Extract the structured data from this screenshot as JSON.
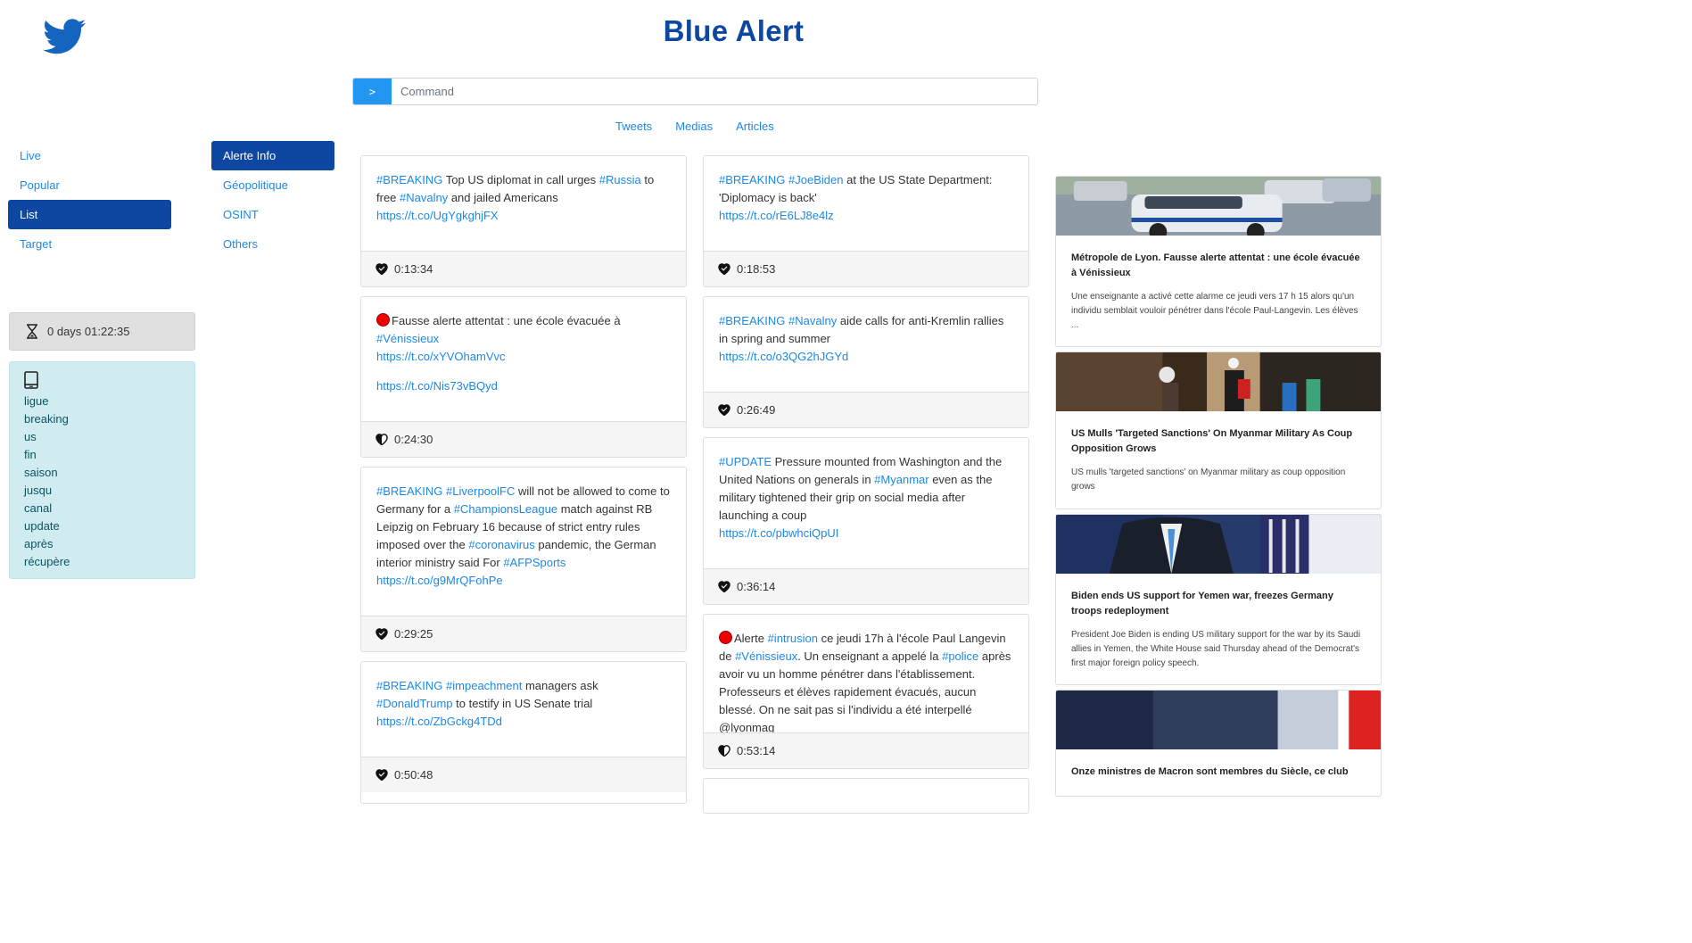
{
  "header": {
    "title": "Blue Alert",
    "logo_icon": "twitter-bird-icon",
    "brand_color": "#0d47a1",
    "accent_color": "#1e88e5"
  },
  "command": {
    "button_label": ">",
    "placeholder": "Command"
  },
  "tabs": [
    "Tweets",
    "Medias",
    "Articles"
  ],
  "nav": {
    "items": [
      "Live",
      "Popular",
      "List",
      "Target"
    ],
    "active": "List"
  },
  "subnav": {
    "items": [
      "Alerte Info",
      "Géopolitique",
      "OSINT",
      "Others"
    ],
    "active": "Alerte Info"
  },
  "timer": {
    "icon": "hourglass-icon",
    "text": "0 days 01:22:35"
  },
  "keywords": {
    "icon": "tablet-icon",
    "items": [
      "ligue",
      "breaking",
      "us",
      "fin",
      "saison",
      "jusqu",
      "canal",
      "update",
      "après",
      "récupère"
    ]
  },
  "tweets": {
    "t1": {
      "parts": [
        "#BREAKING",
        " Top US diplomat in call urges ",
        "#Russia",
        " to free ",
        "#Navalny",
        " and jailed Americans"
      ],
      "link": "https://t.co/UgYgkghjFX",
      "time": "0:13:34",
      "heart": "heart-full-icon"
    },
    "t2": {
      "parts": [
        "#BREAKING",
        " ",
        "#JoeBiden",
        " at the US State Department: 'Diplomacy is back'"
      ],
      "link": "https://t.co/rE6LJ8e4lz",
      "time": "0:18:53",
      "heart": "heart-full-icon"
    },
    "t3": {
      "parts": [
        "Fausse alerte attentat : une école évacuée à ",
        "#Vénissieux"
      ],
      "link": "https://t.co/xYVOhamVvc",
      "link2": "https://t.co/Nis73vBQyd",
      "time": "0:24:30",
      "heart": "heart-half-icon"
    },
    "t4": {
      "parts": [
        "#BREAKING",
        " ",
        "#Navalny",
        " aide calls for anti-Kremlin rallies in spring and summer"
      ],
      "link": "https://t.co/o3QG2hJGYd",
      "time": "0:26:49",
      "heart": "heart-full-icon"
    },
    "t5": {
      "parts": [
        "#BREAKING",
        " ",
        "#LiverpoolFC",
        " will not be allowed to come to Germany for a ",
        "#ChampionsLeague",
        " match against RB Leipzig on February 16 because of strict entry rules imposed over the ",
        "#coronavirus",
        " pandemic, the German interior ministry said For ",
        "#AFPSports"
      ],
      "link": "https://t.co/g9MrQFohPe",
      "time": "0:29:25",
      "heart": "heart-full-icon"
    },
    "t6": {
      "parts": [
        "#UPDATE",
        " Pressure mounted from Washington and the United Nations on generals in ",
        "#Myanmar",
        " even as the military tightened their grip on social media after launching a coup"
      ],
      "link": "https://t.co/pbwhciQpUI",
      "time": "0:36:14",
      "heart": "heart-full-icon"
    },
    "t7": {
      "parts": [
        "#BREAKING",
        " ",
        "#impeachment",
        " managers ask ",
        "#DonaldTrump",
        " to testify in US Senate trial"
      ],
      "link": "https://t.co/ZbGckg4TDd",
      "time": "0:50:48",
      "heart": "heart-full-icon"
    },
    "t8": {
      "parts": [
        "Alerte ",
        "#intrusion",
        " ce jeudi 17h à l'école Paul Langevin de ",
        "#Vénissieux",
        ". Un enseignant a appelé la ",
        "#police",
        " après avoir vu un homme pénétrer dans l'établissement. Professeurs et élèves rapidement évacués, aucun blessé. On ne sait pas si l'individu a été interpellé @lyonmag"
      ],
      "time": "0:53:14",
      "heart": "heart-half-icon"
    }
  },
  "articles": [
    {
      "title": "Métropole de Lyon. Fausse alerte attentat : une école évacuée à Vénissieux",
      "text": "Une enseignante a activé cette alarme ce jeudi vers 17 h 15 alors qu'un individu semblait vouloir pénétrer dans l'école Paul-Langevin. Les élèves ..."
    },
    {
      "title": "US Mulls 'Targeted Sanctions' On Myanmar Military As Coup Opposition Grows",
      "text": "US mulls 'targeted sanctions' on Myanmar military as coup opposition grows"
    },
    {
      "title": "Biden ends US support for Yemen war, freezes Germany troops redeployment",
      "text": "President Joe Biden is ending US military support for the war by its Saudi allies in Yemen, the White House said Thursday ahead of the Democrat's first major foreign policy speech."
    },
    {
      "title": "Onze ministres de Macron sont membres du Siècle, ce club",
      "text": ""
    }
  ]
}
